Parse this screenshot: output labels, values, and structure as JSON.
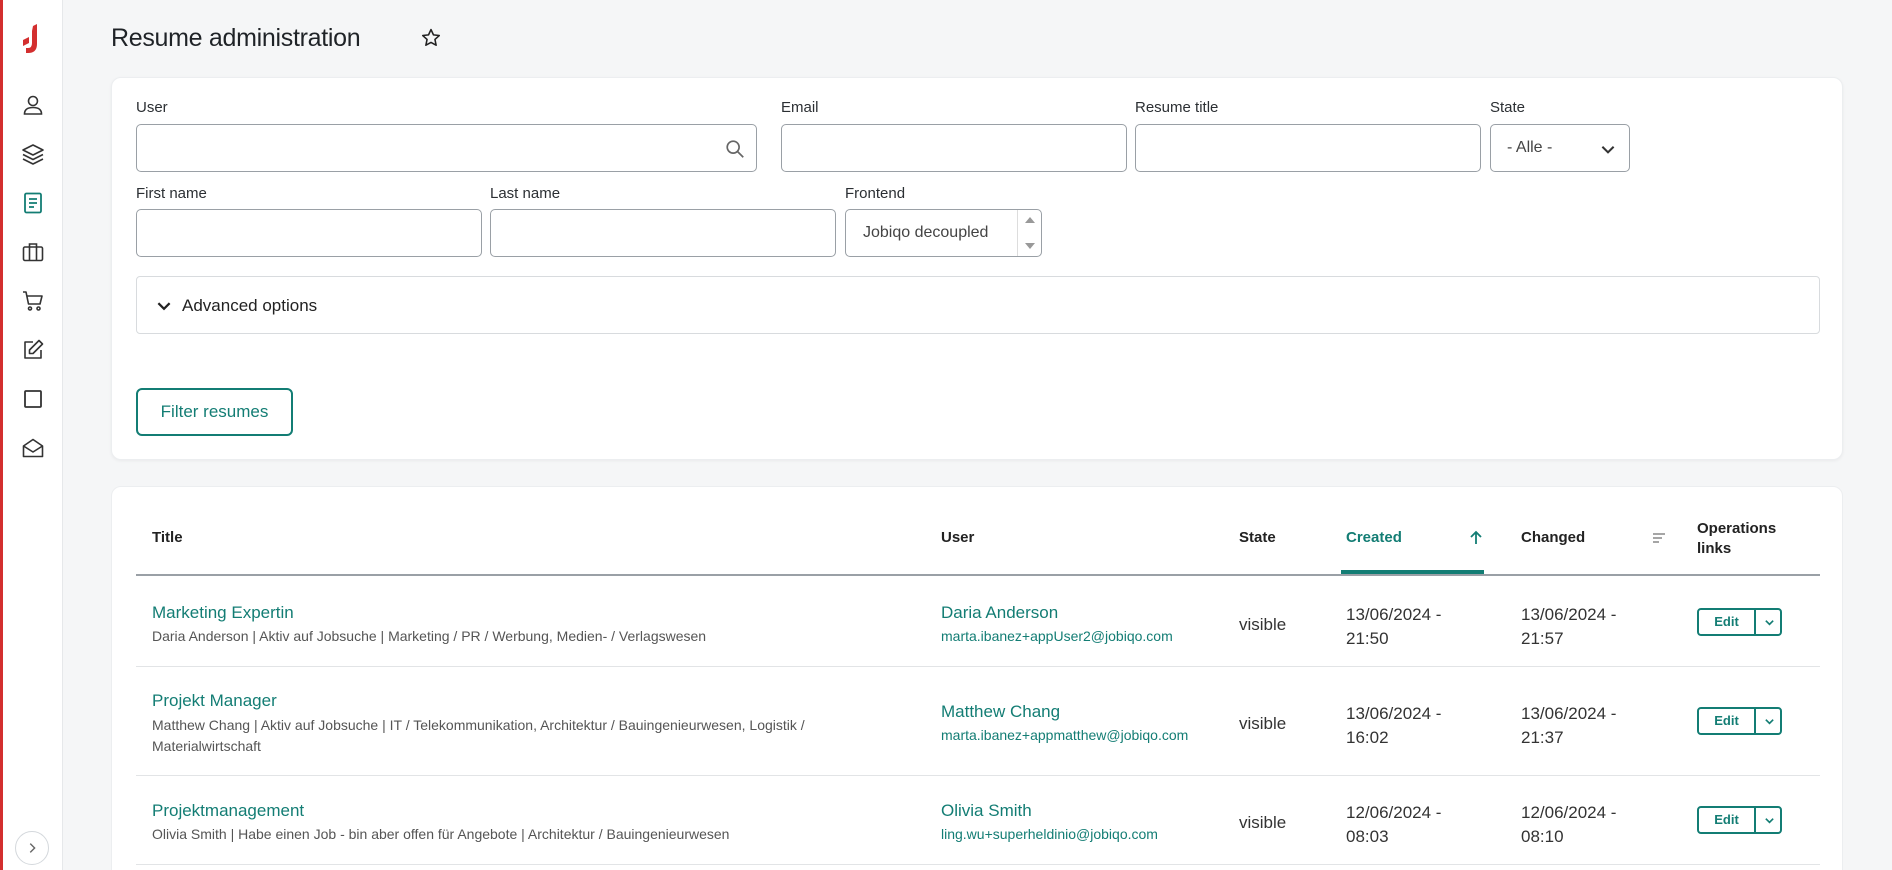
{
  "header": {
    "title": "Resume administration"
  },
  "sidebar": {
    "items": [
      {
        "icon": "user-icon"
      },
      {
        "icon": "layers-icon"
      },
      {
        "icon": "document-icon"
      },
      {
        "icon": "briefcase-icon"
      },
      {
        "icon": "cart-icon"
      },
      {
        "icon": "edit-icon"
      },
      {
        "icon": "square-icon"
      },
      {
        "icon": "mail-open-icon"
      }
    ],
    "active_color": "#137d74",
    "brand_color": "#d32f2f"
  },
  "filters": {
    "user_label": "User",
    "email_label": "Email",
    "resume_title_label": "Resume title",
    "state_label": "State",
    "state_value": "- Alle -",
    "first_name_label": "First name",
    "last_name_label": "Last name",
    "frontend_label": "Frontend",
    "frontend_value": "Jobiqo decoupled",
    "advanced_label": "Advanced options",
    "filter_button": "Filter resumes"
  },
  "table": {
    "headers": {
      "title": "Title",
      "user": "User",
      "state": "State",
      "created": "Created",
      "changed": "Changed",
      "ops": "Operations links"
    },
    "edit_label": "Edit",
    "rows": [
      {
        "title": "Marketing Expertin",
        "desc": "Daria Anderson | Aktiv auf Jobsuche | Marketing / PR / Werbung, Medien- / Verlagswesen",
        "user": "Daria Anderson",
        "email": "marta.ibanez+appUser2@jobiqo.com",
        "state": "visible",
        "created": "13/06/2024 - 21:50",
        "changed": "13/06/2024 - 21:57"
      },
      {
        "title": "Projekt Manager",
        "desc": "Matthew Chang | Aktiv auf Jobsuche | IT / Telekommunikation, Architektur / Bauingenieurwesen, Logistik / Materialwirtschaft",
        "user": "Matthew Chang",
        "email": "marta.ibanez+appmatthew@jobiqo.com",
        "state": "visible",
        "created": "13/06/2024 - 16:02",
        "changed": "13/06/2024 - 21:37"
      },
      {
        "title": "Projektmanagement",
        "desc": "Olivia Smith | Habe einen Job - bin aber offen für Angebote | Architektur / Bauingenieurwesen",
        "user": "Olivia Smith",
        "email": "ling.wu+superheldinio@jobiqo.com",
        "state": "visible",
        "created": "12/06/2024 - 08:03",
        "changed": "12/06/2024 - 08:10"
      }
    ]
  }
}
